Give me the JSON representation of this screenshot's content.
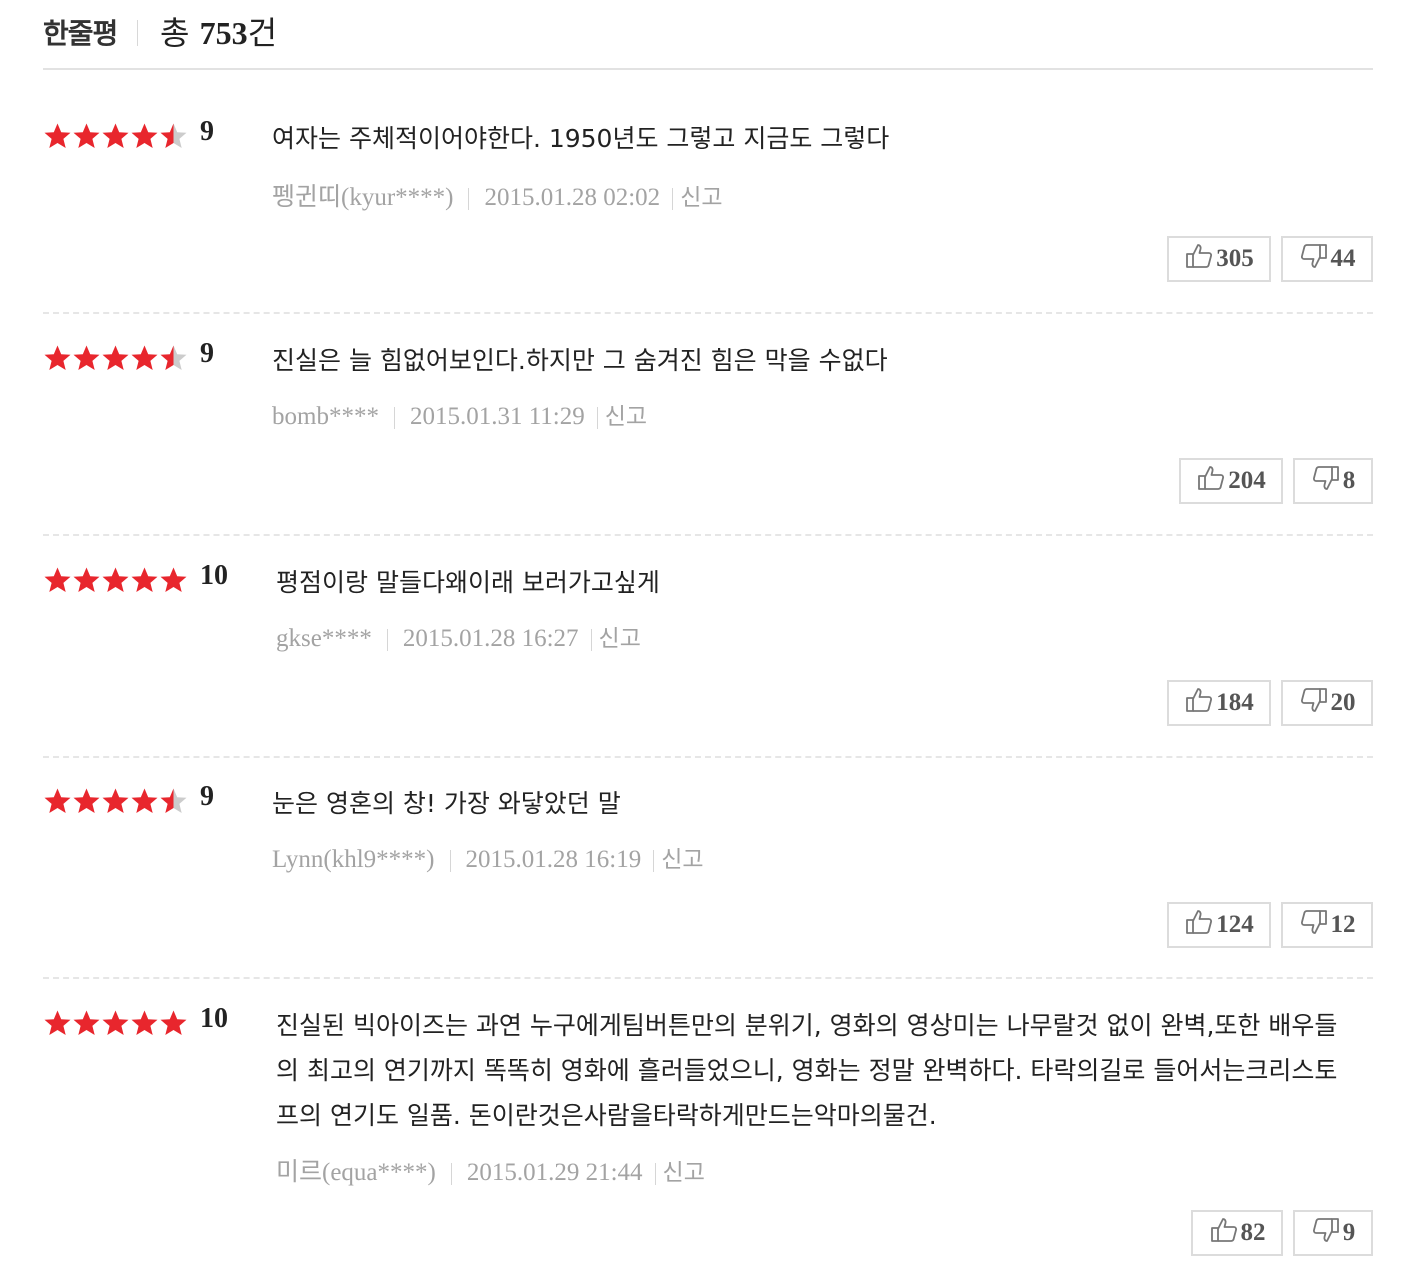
{
  "header": {
    "title": "한줄평",
    "count_prefix": "총 ",
    "count_value": "753",
    "count_suffix": "건"
  },
  "colors": {
    "star_on": "#e8262d",
    "star_off": "#cccccc",
    "meta": "#a3a3a3"
  },
  "reviews": [
    {
      "rating": 9,
      "score": "9",
      "text": "여자는 주체적이어야한다. 1950년도 그렇고 지금도 그렇다",
      "author": "펭귄띠(kyur****)",
      "date": "2015.01.28 02:02",
      "report": "신고",
      "likes": "305",
      "dislikes": "44"
    },
    {
      "rating": 9,
      "score": "9",
      "text": "진실은 늘 힘없어보인다.하지만 그 숨겨진 힘은 막을 수없다",
      "author": "bomb****",
      "date": "2015.01.31 11:29",
      "report": "신고",
      "likes": "204",
      "dislikes": "8"
    },
    {
      "rating": 10,
      "score": "10",
      "text": "평점이랑 말들다왜이래 보러가고싶게",
      "author": "gkse****",
      "date": "2015.01.28 16:27",
      "report": "신고",
      "likes": "184",
      "dislikes": "20"
    },
    {
      "rating": 9,
      "score": "9",
      "text": "눈은 영혼의 창! 가장 와닿았던 말",
      "author": "Lynn(khl9****)",
      "date": "2015.01.28 16:19",
      "report": "신고",
      "likes": "124",
      "dislikes": "12"
    },
    {
      "rating": 10,
      "score": "10",
      "text": "진실된 빅아이즈는 과연 누구에게팀버튼만의 분위기, 영화의 영상미는 나무랄것 없이 완벽,또한 배우들의 최고의 연기까지 똑똑히 영화에 흘러들었으니, 영화는 정말 완벽하다. 타락의길로 들어서는크리스토프의 연기도 일품. 돈이란것은사람을타락하게만드는악마의물건.",
      "author": "미르(equa****)",
      "date": "2015.01.29 21:44",
      "report": "신고",
      "likes": "82",
      "dislikes": "9"
    }
  ]
}
